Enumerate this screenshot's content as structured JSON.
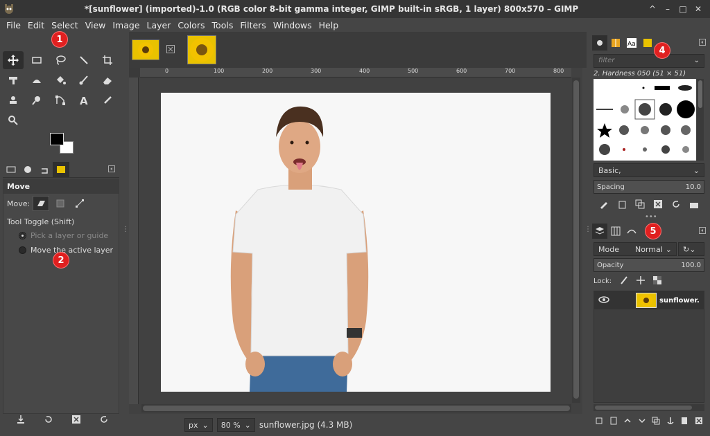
{
  "window": {
    "title": "*[sunflower] (imported)-1.0 (RGB color 8-bit gamma integer, GIMP built-in sRGB, 1 layer) 800x570 – GIMP",
    "minimize": "^",
    "restore": "–",
    "maximize": "□",
    "close": "✕"
  },
  "menu": [
    "File",
    "Edit",
    "Select",
    "View",
    "Image",
    "Layer",
    "Colors",
    "Tools",
    "Filters",
    "Windows",
    "Help"
  ],
  "badges": [
    "1",
    "2",
    "4",
    "5"
  ],
  "tool_options": {
    "title": "Move",
    "move_label": "Move:",
    "toggle_label": "Tool Toggle  (Shift)",
    "option_pick": "Pick a layer or guide",
    "option_move": "Move the active layer"
  },
  "ruler_ticks": [
    "0",
    "100",
    "200",
    "300",
    "400",
    "500",
    "600",
    "700",
    "800"
  ],
  "status": {
    "unit": "px",
    "zoom": "80 %",
    "file": "sunflower.jpg (4.3 MB)"
  },
  "brushes": {
    "filter_placeholder": "filter",
    "selected": "2. Hardness 050 (51 × 51)",
    "tag": "Basic,",
    "spacing_label": "Spacing",
    "spacing_value": "10.0"
  },
  "layers": {
    "mode_label": "Mode",
    "mode_value": "Normal",
    "opacity_label": "Opacity",
    "opacity_value": "100.0",
    "lock_label": "Lock:",
    "layer_name": "sunflower."
  }
}
